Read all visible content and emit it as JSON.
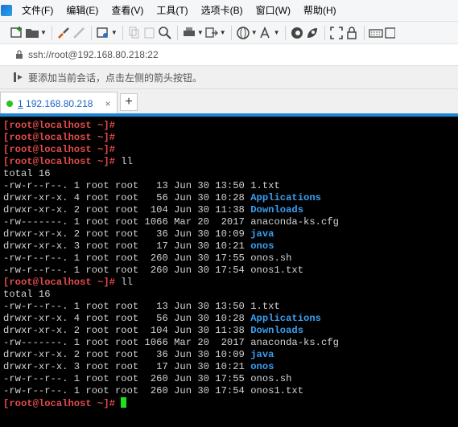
{
  "menu": [
    "文件(F)",
    "编辑(E)",
    "查看(V)",
    "工具(T)",
    "选项卡(B)",
    "窗口(W)",
    "帮助(H)"
  ],
  "address": {
    "url": "ssh://root@192.168.80.218:22"
  },
  "hint": {
    "text": "要添加当前会话，点击左侧的箭头按钮。"
  },
  "tabs": [
    {
      "index": "1",
      "label": "192.168.80.218",
      "close": "×"
    }
  ],
  "tab_add": "+",
  "colors": {
    "prompt": "#e24a4a",
    "directory": "#3a9ef0",
    "cursor": "#1fe01f",
    "tab_accent": "#1e84d4",
    "status_dot": "#26c426"
  },
  "terminal": {
    "lines": [
      {
        "prompt": "[root@localhost ~]#",
        "cmd": ""
      },
      {
        "prompt": "[root@localhost ~]#",
        "cmd": ""
      },
      {
        "prompt": "[root@localhost ~]#",
        "cmd": ""
      },
      {
        "prompt": "[root@localhost ~]#",
        "cmd": " ll"
      },
      {
        "text": "total 16"
      },
      {
        "text": "-rw-r--r--. 1 root root   13 Jun 30 13:50 ",
        "name": "1.txt"
      },
      {
        "text": "drwxr-xr-x. 4 root root   56 Jun 30 10:28 ",
        "dir": "Applications"
      },
      {
        "text": "drwxr-xr-x. 2 root root  104 Jun 30 11:38 ",
        "dir": "Downloads"
      },
      {
        "text": "-rw-------. 1 root root 1066 Mar 20  2017 ",
        "name": "anaconda-ks.cfg"
      },
      {
        "text": "drwxr-xr-x. 2 root root   36 Jun 30 10:09 ",
        "dir": "java"
      },
      {
        "text": "drwxr-xr-x. 3 root root   17 Jun 30 10:21 ",
        "dir": "onos"
      },
      {
        "text": "-rw-r--r--. 1 root root  260 Jun 30 17:55 ",
        "name": "onos.sh"
      },
      {
        "text": "-rw-r--r--. 1 root root  260 Jun 30 17:54 ",
        "name": "onos1.txt"
      },
      {
        "prompt": "[root@localhost ~]#",
        "cmd": " ll"
      },
      {
        "text": "total 16"
      },
      {
        "text": "-rw-r--r--. 1 root root   13 Jun 30 13:50 ",
        "name": "1.txt"
      },
      {
        "text": "drwxr-xr-x. 4 root root   56 Jun 30 10:28 ",
        "dir": "Applications"
      },
      {
        "text": "drwxr-xr-x. 2 root root  104 Jun 30 11:38 ",
        "dir": "Downloads"
      },
      {
        "text": "-rw-------. 1 root root 1066 Mar 20  2017 ",
        "name": "anaconda-ks.cfg"
      },
      {
        "text": "drwxr-xr-x. 2 root root   36 Jun 30 10:09 ",
        "dir": "java"
      },
      {
        "text": "drwxr-xr-x. 3 root root   17 Jun 30 10:21 ",
        "dir": "onos"
      },
      {
        "text": "-rw-r--r--. 1 root root  260 Jun 30 17:55 ",
        "name": "onos.sh"
      },
      {
        "text": "-rw-r--r--. 1 root root  260 Jun 30 17:54 ",
        "name": "onos1.txt"
      },
      {
        "prompt": "[root@localhost ~]#",
        "cmd": " ",
        "cursor": true
      }
    ]
  }
}
